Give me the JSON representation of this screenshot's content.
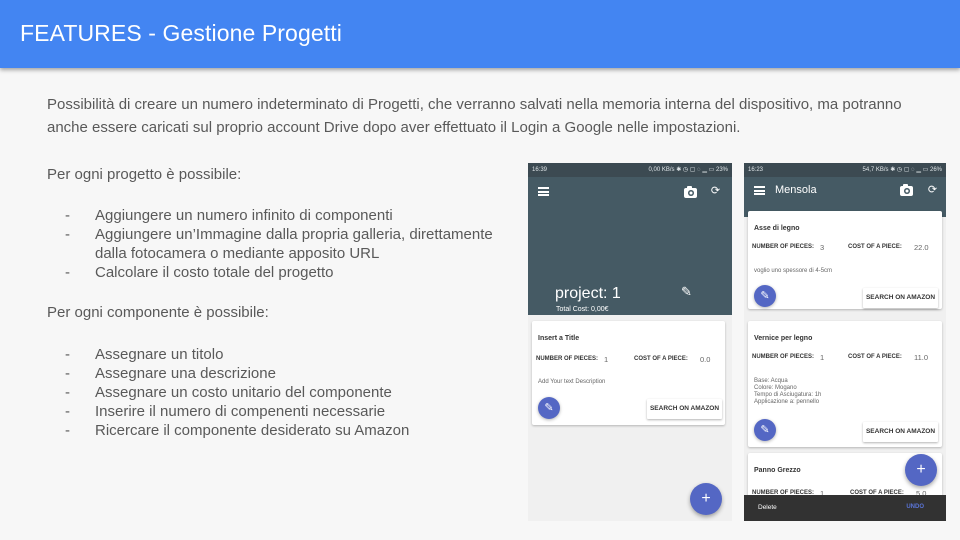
{
  "slide": {
    "title": "FEATURES - Gestione Progetti",
    "intro": "Possibilità di creare un numero indeterminato di Progetti, che verranno salvati nella memoria interna del dispositivo, ma potranno anche essere caricati sul proprio account Drive dopo aver effettuato il Login a Google nelle impostazioni.",
    "project_heading": "Per ogni progetto è possibile:",
    "project_items": [
      "Aggiungere un numero infinito di componenti",
      "Aggiungere un’Immagine dalla propria galleria, direttamente dalla fotocamera o mediante apposito URL",
      "Calcolare il costo totale del progetto"
    ],
    "component_heading": "Per ogni componente è possibile:",
    "component_items": [
      "Assegnare un titolo",
      "Assegnare una descrizione",
      "Assegnare un costo unitario del componente",
      "Inserire il numero di compenenti necessarie",
      "Ricercare il componente desiderato su Amazon"
    ],
    "accent_color": "#4385f2"
  },
  "phone1": {
    "status_time": "16:39",
    "status_right": "0,00 KB/s ✱ ◷ ▢ ◌ ▁ ▭ 23%",
    "project_name": "project: 1",
    "total_cost": "Total Cost: 0,00€",
    "card": {
      "title": "Insert a Title",
      "pieces_label": "NUMBER OF PIECES:",
      "pieces_value": "1",
      "cost_label": "COST OF A PIECE:",
      "cost_value": "0.0",
      "description": "Add Your text Description",
      "amazon_button": "SEARCH ON AMAZON"
    },
    "fab_icon": "plus-icon",
    "appbar_color": "#455a64"
  },
  "phone2": {
    "status_time": "16:23",
    "status_right": "54,7 KB/s ✱ ◷ ▢ ◌ ▁ ▭ 26%",
    "title": "Mensola",
    "cards": [
      {
        "title": "Asse di legno",
        "pieces_label": "NUMBER OF PIECES:",
        "pieces_value": "3",
        "cost_label": "COST OF A PIECE:",
        "cost_value": "22.0",
        "description": "voglio uno spessore di 4-5cm",
        "amazon_button": "SEARCH ON AMAZON"
      },
      {
        "title": "Vernice per legno",
        "pieces_label": "NUMBER OF PIECES:",
        "pieces_value": "1",
        "cost_label": "COST OF A PIECE:",
        "cost_value": "11.0",
        "description_lines": [
          "Base: Acqua",
          "Colore: Mogano",
          "Tempo di Asciugatura: 1h",
          "Applicazione a: pennello"
        ],
        "amazon_button": "SEARCH ON AMAZON"
      },
      {
        "title": "Panno Grezzo",
        "pieces_label": "NUMBER OF PIECES:",
        "pieces_value": "1",
        "cost_label": "COST OF A PIECE:",
        "cost_value": "5.0"
      }
    ],
    "snackbar": {
      "delete": "Delete",
      "undo": "UNDO"
    },
    "fab_color": "#5467c4"
  }
}
